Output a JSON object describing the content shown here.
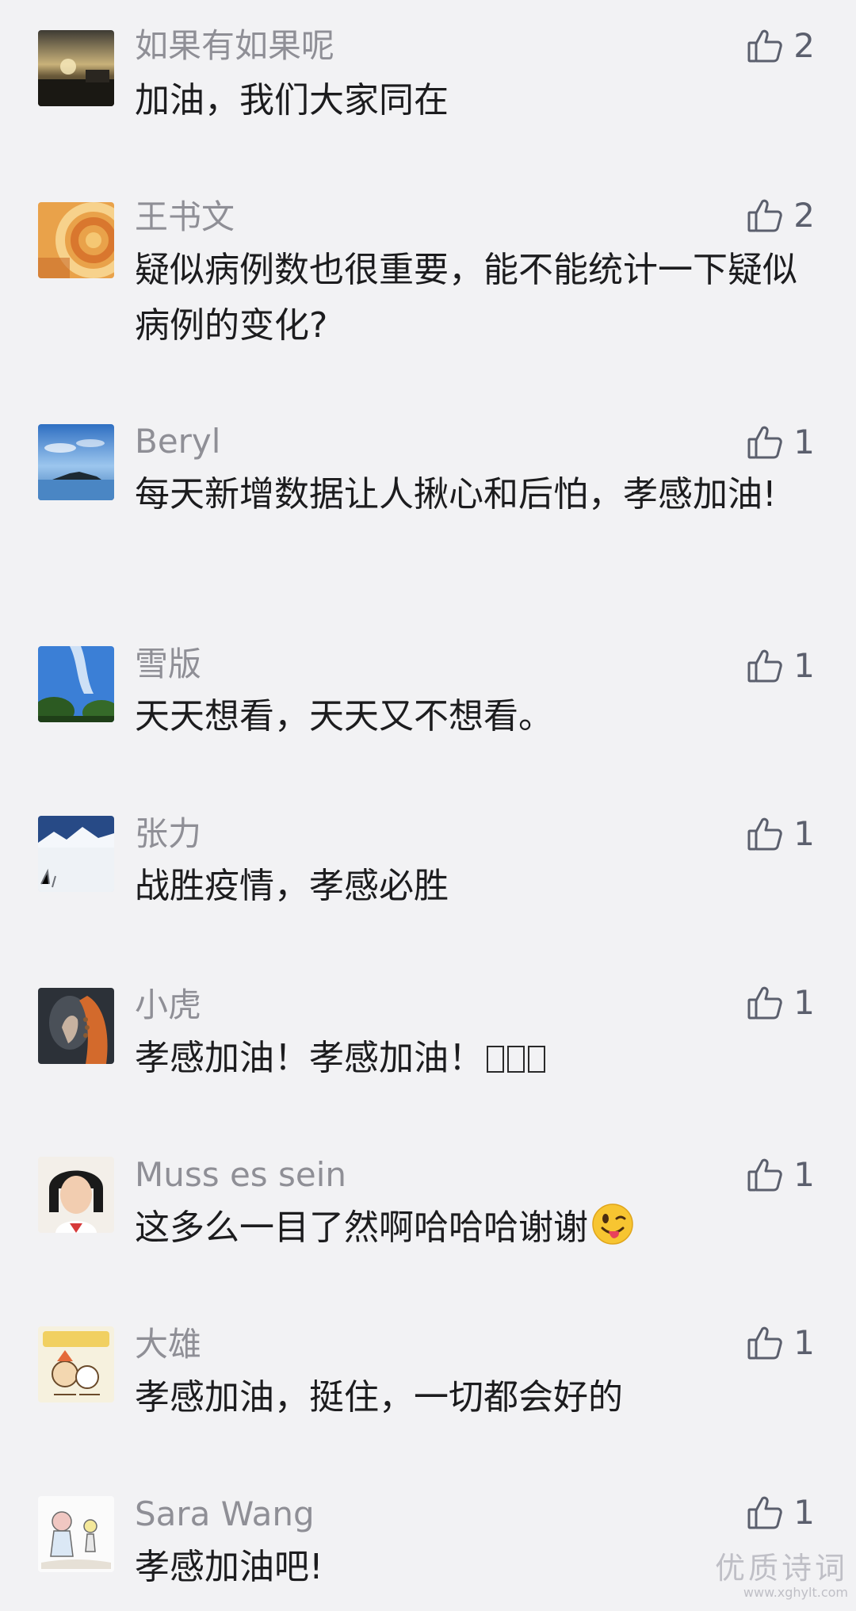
{
  "comments": [
    {
      "name": "如果有如果呢",
      "text": "加油，我们大家同在",
      "likes": "2",
      "avatar": "avatar-sunset-photo"
    },
    {
      "name": "王书文",
      "text": "疑似病例数也很重要，能不能统计一下疑似病例的变化?",
      "likes": "2",
      "avatar": "avatar-orange-swirl-photo"
    },
    {
      "name": "Beryl",
      "text": "每天新增数据让人揪心和后怕，孝感加油!",
      "likes": "1",
      "avatar": "avatar-island-sky-photo"
    },
    {
      "name": "雪版",
      "text": "天天想看，天天又不想看。",
      "likes": "1",
      "avatar": "avatar-blue-sky-trees-photo"
    },
    {
      "name": "张力",
      "text": "战胜疫情，孝感必胜",
      "likes": "1",
      "avatar": "avatar-snow-mountain-photo"
    },
    {
      "name": "小虎",
      "text": "孝感加油！孝感加油！",
      "likes": "1",
      "avatar": "avatar-praying-hands-photo"
    },
    {
      "name": "Muss es sein",
      "text": "这多么一目了然啊哈哈哈谢谢",
      "likes": "1",
      "avatar": "avatar-woman-portrait-photo"
    },
    {
      "name": "大雄",
      "text": "孝感加油，挺住，一切都会好的",
      "likes": "1",
      "avatar": "avatar-cartoon-sticker"
    },
    {
      "name": "Sara Wang",
      "text": "孝感加油吧!",
      "likes": "1",
      "avatar": "avatar-cartoon-sketch"
    }
  ],
  "icons": {
    "like": "thumbs-up-icon",
    "emoji": "winking-tongue-emoji-icon",
    "missing_glyph": "missing-glyph-box"
  },
  "colors": {
    "background": "#f2f2f4",
    "name": "#8f8f96",
    "text": "#1c1c1e",
    "like": "#5b5f6d"
  },
  "watermark": {
    "cn": "优质诗词",
    "url": "www.xghylt.com"
  }
}
